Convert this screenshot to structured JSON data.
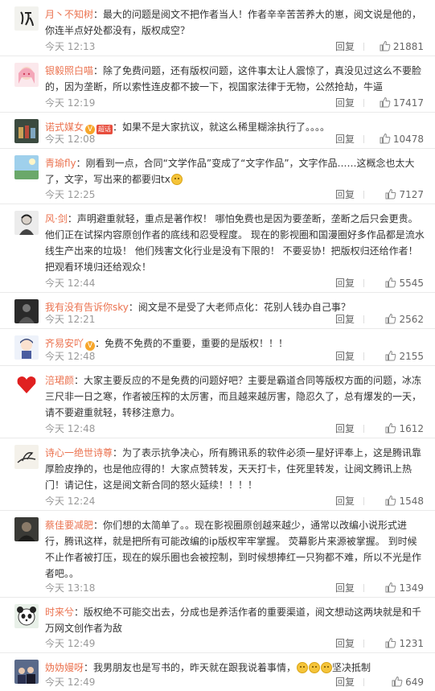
{
  "ui": {
    "reply_label": "回复"
  },
  "colors": {
    "username": "#eb7350",
    "text": "#333333",
    "meta": "#999999",
    "divider": "#eaeaea"
  },
  "comments": [
    {
      "user": "月丶不知树",
      "badges": [],
      "text": "：最大的问题是阅文不把作者当人！作者辛辛苦苦养大的崽，阅文说是他的，你连半点好处都没有，版权成空？",
      "text_tail": "",
      "time": "今天 12:13",
      "likes": "21881",
      "avatar": "calligraphy"
    },
    {
      "user": "银毅照白喵",
      "badges": [],
      "text": "：除了免费问题，还有版权问题，这件事太让人震惊了，真没见过这么不要脸的，因为垄断，所以索性连皮都不披一下，视国家法律于无物，公然抢劫，牛逼",
      "text_tail": "",
      "time": "今天 12:19",
      "likes": "17417",
      "avatar": "anime-girl"
    },
    {
      "user": "诺式媒女",
      "badges": [
        "V",
        "超话"
      ],
      "text": "：如果不是大家抗议，就这么稀里糊涂执行了。。。。",
      "text_tail": "",
      "time": "今天 12:08",
      "likes": "10478",
      "avatar": "drinks"
    },
    {
      "user": "青瑜fly",
      "badges": [],
      "text": "：刚看到一点，合同“文学作品”变成了“文字作品”，文字作品……这概念也太大了，文字，写出来的都要归tx",
      "text_tail": "",
      "emojis": 1,
      "time": "今天 12:25",
      "likes": "7127",
      "avatar": "landscape"
    },
    {
      "user": "风·剑",
      "badges": [],
      "text": "：声明避重就轻，重点是著作权！ 哪怕免费也是因为要垄断，垄断之后只会更贵。他们正在试探内容原创作者的底线和忍受程度。 现在的影视圈和国漫圈好多作品都是流水线生产出来的垃圾！ 他们残害文化行业是没有下限的！ 不要妥协！把版权归还给作者！把观看环境归还给观众！",
      "text_tail": "",
      "time": "今天 12:44",
      "likes": "5545",
      "avatar": "man-sketch"
    },
    {
      "user": "我有没有告诉你sky",
      "badges": [],
      "text": "：阅文是不是受了大老师点化：花别人钱办自己事？",
      "text_tail": "",
      "time": "今天 12:21",
      "likes": "2562",
      "avatar": "dark-figure"
    },
    {
      "user": "齐易安吖",
      "badges": [
        "V"
      ],
      "text": "：免费不免费的不重要，重要的是版权！！！",
      "text_tail": "",
      "time": "今天 12:48",
      "likes": "2155",
      "avatar": "chibi"
    },
    {
      "user": "涪珺颜",
      "badges": [],
      "text": "：大家主要反应的不是免费的问题好吧？主要是霸道合同等版权方面的问题，冰冻三尺非一日之寒，作者被压榨的太厉害，而且越来越厉害，隐忍久了，总有爆发的一天，请不要避重就轻，转移注意力。",
      "text_tail": "",
      "time": "今天 12:48",
      "likes": "1612",
      "avatar": "heart"
    },
    {
      "user": "诗心一绝世诗尊",
      "badges": [],
      "text": "：为了表示抗争决心，所有腾讯系的软件必须一星好评奉上，这是腾讯靠厚脸皮挣的，也是他应得的！大家点赞转发，天天打卡，住死里转发，让阅文腾讯上热门！请记住，这是阅文新合同的怒火延续！！！！",
      "text_tail": "",
      "time": "今天 12:24",
      "likes": "1548",
      "avatar": "ink-bird"
    },
    {
      "user": "蔡佳要减肥",
      "badges": [],
      "text": "：你们想的太简单了。。现在影视圈原创越来越少，通常以改编小说形式进行，腾讯这样，就是把所有可能改编的ip版权牢牢掌握。 荧幕影片来源被掌握。 到时候不止作者被打压，现在的娱乐圈也会被控制，到时候想捧红一只狗都不难，所以不光是作者吧。。",
      "text_tail": "",
      "time": "今天 13:18",
      "likes": "1349",
      "avatar": "dark-portrait"
    },
    {
      "user": "时来兮",
      "badges": [],
      "text": "：版权绝不可能交出去，分成也是养活作者的重要渠道，阅文想动这两块就是和千万网文创作者为敌",
      "text_tail": "",
      "time": "今天 12:49",
      "likes": "1231",
      "avatar": "panda"
    },
    {
      "user": "妫妫嫚呀",
      "badges": [],
      "text": "：我男朋友也是写书的，昨天就在跟我说着事情，",
      "text_tail": "坚决抵制",
      "emojis": 3,
      "time": "今天 12:49",
      "likes": "649",
      "avatar": "group-photo"
    }
  ]
}
